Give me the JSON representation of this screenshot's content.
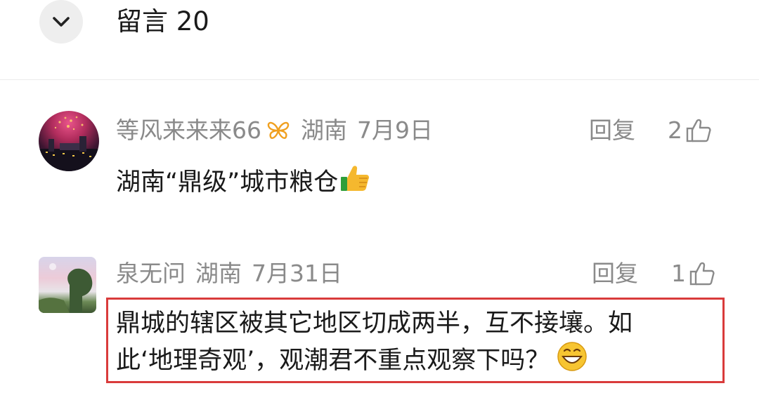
{
  "header": {
    "title": "留言 20",
    "collapse_icon": "chevron-down-icon"
  },
  "comments": [
    {
      "username": "等风来来来66",
      "badge_icon": "butterfly-icon",
      "location": "湖南",
      "date": "7月9日",
      "reply_label": "回复",
      "like_count": "2",
      "text": "湖南“鼎级”城市粮仓",
      "emoji": "thumbs-up-emoji"
    },
    {
      "username": "泉无问",
      "location": "湖南",
      "date": "7月31日",
      "reply_label": "回复",
      "like_count": "1",
      "text_lines": [
        "鼎城的辖区被其它地区切成两半，互不接壤。如",
        "此‘地理奇观’，观潮君不重点观察下吗？"
      ],
      "emoji": "grinning-face-emoji",
      "highlight_color": "#d93b3b"
    }
  ],
  "colors": {
    "text_primary": "#1a1a1a",
    "text_secondary": "#8a8a8a",
    "badge_orange": "#f0a020"
  }
}
